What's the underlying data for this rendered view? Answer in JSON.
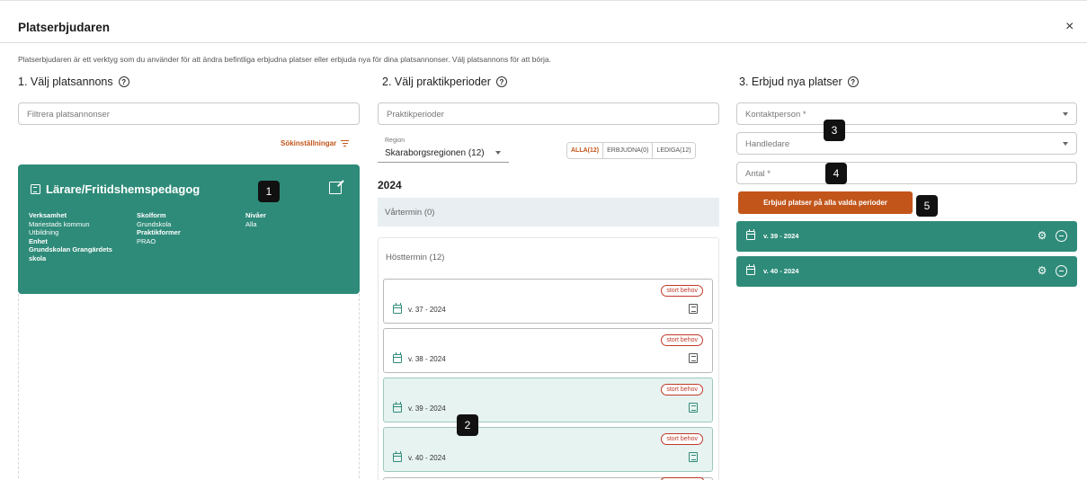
{
  "dialog": {
    "title": "Platserbjudaren",
    "close_label": "×",
    "description": "Platserbjudaren är ett verktyg som du använder för att ändra befintliga erbjudna platser eller erbjuda nya för dina platsannonser. Välj platsannons för att börja."
  },
  "col1": {
    "heading": "1. Välj platsannons",
    "filter_placeholder": "Filtrera platsannonser",
    "search_settings_label": "Sökinställningar",
    "card": {
      "title": "Lärare/Fritidshemspedagog",
      "col_a": [
        {
          "label": "Verksamhet",
          "value": "Mariestads kommun"
        },
        {
          "label": "",
          "value": "Utbildning"
        },
        {
          "label": "Enhet",
          "value": "Grundskolan Grangärdets skola"
        }
      ],
      "col_b": [
        {
          "label": "Skolform",
          "value": "Grundskola"
        },
        {
          "label": "Praktikformer",
          "value": "PRAO"
        }
      ],
      "col_c": [
        {
          "label": "Nivåer",
          "value": "Alla"
        }
      ]
    }
  },
  "col2": {
    "heading": "2. Välj praktikperioder",
    "periods_placeholder": "Praktikperioder",
    "region_label": "Region",
    "region_value": "Skaraborgsregionen (12)",
    "tabs": [
      "ALLA(12)",
      "ERBJUDNA(0)",
      "LEDIGA(12)"
    ],
    "active_tab": "ALLA(12)",
    "year": "2024",
    "spring_term": "Vårtermin (0)",
    "autumn_term": "Hösttermin (12)",
    "periods": [
      {
        "name": "v. 37 - 2024",
        "tag": "stort behov",
        "selected": false
      },
      {
        "name": "v. 38 - 2024",
        "tag": "stort behov",
        "selected": false
      },
      {
        "name": "v. 39 - 2024",
        "tag": "stort behov",
        "selected": true
      },
      {
        "name": "v. 40 - 2024",
        "tag": "stort behov",
        "selected": true
      }
    ]
  },
  "col3": {
    "heading": "3. Erbjud nya platser",
    "contact_placeholder": "Kontaktperson *",
    "supervisor_placeholder": "Handledare",
    "count_placeholder": "Antal *",
    "offer_button": "Erbjud platser på alla valda perioder",
    "selected_periods": [
      "v. 39 - 2024",
      "v. 40 - 2024"
    ]
  },
  "badges": [
    "1",
    "2",
    "3",
    "4",
    "5"
  ],
  "colors": {
    "accent_green": "#2e8b79",
    "accent_orange": "#c2551a",
    "tag_red": "#c0392b"
  }
}
